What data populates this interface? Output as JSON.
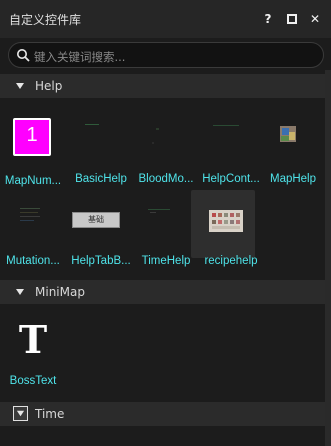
{
  "window": {
    "title": "自定义控件库"
  },
  "titlebar": {
    "help_glyph": "?",
    "close_glyph": "✕"
  },
  "search": {
    "placeholder": "键入关键词搜索..."
  },
  "sections": [
    {
      "label": "Help",
      "items": [
        {
          "name": "MapNum...",
          "thumb": "number-badge",
          "badge_text": "1",
          "badge_color": "#ff00ff"
        },
        {
          "name": "BasicHelp",
          "thumb": "blank-preview"
        },
        {
          "name": "BloodMo...",
          "thumb": "blank-preview"
        },
        {
          "name": "HelpCont...",
          "thumb": "blank-preview"
        },
        {
          "name": "MapHelp",
          "thumb": "map-preview"
        },
        {
          "name": "Mutation...",
          "thumb": "text-preview"
        },
        {
          "name": "HelpTabB...",
          "thumb": "button-preview",
          "button_text": "基础"
        },
        {
          "name": "TimeHelp",
          "thumb": "blank-preview"
        },
        {
          "name": "recipehelp",
          "thumb": "grid-preview"
        }
      ]
    },
    {
      "label": "MiniMap",
      "items": [
        {
          "name": "BossText",
          "thumb": "text-T",
          "glyph": "T"
        }
      ]
    },
    {
      "label": "Time",
      "items": []
    }
  ],
  "colors": {
    "accent_text": "#4fe4ea",
    "background": "#1c1c1c",
    "section_bar": "#2b2b2b"
  }
}
